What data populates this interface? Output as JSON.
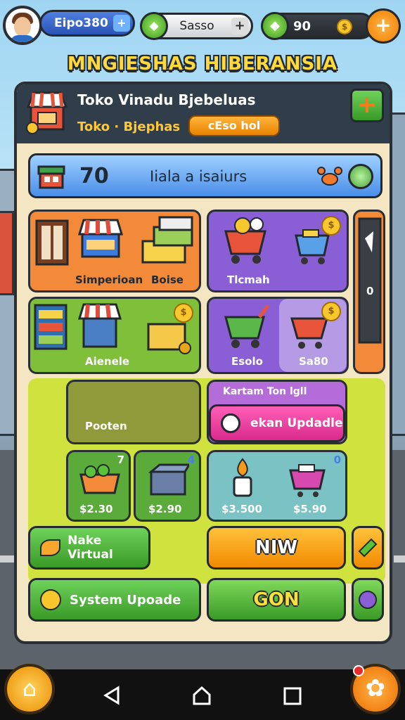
{
  "hud": {
    "money": "Eipo380 $",
    "money_plus": "+",
    "gems": "Sasso",
    "gems_plus": "+",
    "coins": "90",
    "add_button": "+"
  },
  "title": "MNGIESHAS HIBERANSIA",
  "shop": {
    "name": "Toko Vinadu Bjebeluas",
    "subtitle": "Toko · Bjephas",
    "badge": "cEso hol",
    "add_button": "+"
  },
  "info_bar": {
    "count": "70",
    "label": "Iiala a isaiurs"
  },
  "tiles": {
    "simperion": "Simperioan",
    "boise": "Boise",
    "tlcmah": "Tlcmah",
    "side_count": "0",
    "aienele": "Aienele",
    "esolo": "Esolo",
    "saso": "Sa80",
    "pooten": "Pooten",
    "kartam_header": "Kartam Ton lgll",
    "ekan_update": "ekan Updadle",
    "item1_price": "$2.30",
    "item1_badge": "7",
    "item2_price": "$2.90",
    "item2_badge": "4",
    "item3_price": "$3.500",
    "item4_price": "$5.90",
    "item4_badge": "0"
  },
  "actions": {
    "make_virtual": "Nake Virtual",
    "new": "NIW",
    "system_update": "System Upoade",
    "gon": "GON"
  },
  "colors": {
    "orange_tile": "#f28a3a",
    "purple_tile": "#8a5fd6",
    "green_tile": "#7fbf3a",
    "lime_panel": "#cfe23d",
    "teal_tile": "#7ac2c4",
    "pink_button": "#e63ea0",
    "blue_bar": "#4a8ee8"
  }
}
